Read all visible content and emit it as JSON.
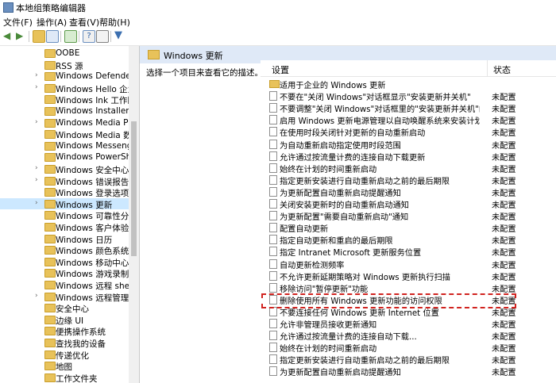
{
  "window": {
    "title": "本地组策略编辑器"
  },
  "menu": [
    "文件(F)",
    "操作(A)",
    "查看(V)",
    "帮助(H)"
  ],
  "toolbar_icons": [
    "back-icon",
    "forward-icon",
    "up-folder-icon",
    "show-hide-tree-icon",
    "export-icon",
    "help-icon",
    "properties-icon",
    "filter-icon"
  ],
  "tree": {
    "items": [
      {
        "label": "OOBE",
        "expandable": false
      },
      {
        "label": "RSS 源",
        "expandable": false
      },
      {
        "label": "Windows Defender Sr",
        "expandable": true
      },
      {
        "label": "Windows Hello 企业版",
        "expandable": true
      },
      {
        "label": "Windows Ink 工作区",
        "expandable": false
      },
      {
        "label": "Windows Installer",
        "expandable": false
      },
      {
        "label": "Windows Media Playe",
        "expandable": true
      },
      {
        "label": "Windows Media 数字权",
        "expandable": false
      },
      {
        "label": "Windows Messenger",
        "expandable": false
      },
      {
        "label": "Windows PowerShell",
        "expandable": false
      },
      {
        "label": "Windows 安全中心",
        "expandable": true
      },
      {
        "label": "Windows 错误报告",
        "expandable": true
      },
      {
        "label": "Windows 登录选项",
        "expandable": false
      },
      {
        "label": "Windows 更新",
        "expandable": true,
        "selected": true
      },
      {
        "label": "Windows 可靠性分析",
        "expandable": false
      },
      {
        "label": "Windows 客户体验改善",
        "expandable": false
      },
      {
        "label": "Windows 日历",
        "expandable": false
      },
      {
        "label": "Windows 颜色系统",
        "expandable": false
      },
      {
        "label": "Windows 移动中心",
        "expandable": false
      },
      {
        "label": "Windows 游戏录制和广",
        "expandable": false
      },
      {
        "label": "Windows 远程 shell",
        "expandable": false
      },
      {
        "label": "Windows 远程管理(Wi",
        "expandable": true
      },
      {
        "label": "安全中心",
        "expandable": false
      },
      {
        "label": "边缘 UI",
        "expandable": false
      },
      {
        "label": "便携操作系统",
        "expandable": false
      },
      {
        "label": "查找我的设备",
        "expandable": false
      },
      {
        "label": "传递优化",
        "expandable": false
      },
      {
        "label": "地图",
        "expandable": false
      },
      {
        "label": "工作文件夹",
        "expandable": false
      }
    ]
  },
  "right": {
    "header": "Windows 更新",
    "description": "选择一个项目来查看它的描述。",
    "col_setting": "设置",
    "col_state": "状态",
    "rows": [
      {
        "name": "适用于企业的 Windows 更新",
        "state": "",
        "folder": true
      },
      {
        "name": "不要在\"关闭 Windows\"对话框显示\"安装更新并关机\"",
        "state": "未配置"
      },
      {
        "name": "不要调整\"关闭 Windows\"对话框里的\"安装更新并关机\"的默...",
        "state": "未配置"
      },
      {
        "name": "启用 Windows 更新电源管理以自动唤醒系统来安装计划的...",
        "state": "未配置"
      },
      {
        "name": "在使用时段关闭针对更新的自动重新启动",
        "state": "未配置"
      },
      {
        "name": "为自动重新启动指定使用时段范围",
        "state": "未配置"
      },
      {
        "name": "允许通过按流量计费的连接自动下载更新",
        "state": "未配置"
      },
      {
        "name": "始终在计划的时间重新启动",
        "state": "未配置"
      },
      {
        "name": "指定更新安装进行自动重新启动之前的最后期限",
        "state": "未配置"
      },
      {
        "name": "为更新配置自动重新启动提醒通知",
        "state": "未配置"
      },
      {
        "name": "关闭安装更新时的自动重新启动通知",
        "state": "未配置"
      },
      {
        "name": "为更新配置\"需要自动重新启动\"通知",
        "state": "未配置"
      },
      {
        "name": "配置自动更新",
        "state": "未配置"
      },
      {
        "name": "指定自动更新和重启的最后期限",
        "state": "未配置"
      },
      {
        "name": "指定 Intranet Microsoft 更新服务位置",
        "state": "未配置"
      },
      {
        "name": "自动更新检测频率",
        "state": "未配置"
      },
      {
        "name": "不允许更新延期策略对 Windows 更新执行扫描",
        "state": "未配置"
      },
      {
        "name": "移除访问\"暂停更新\"功能",
        "state": "未配置"
      },
      {
        "name": "删除使用所有 Windows 更新功能的访问权限",
        "state": "未配置"
      },
      {
        "name": "不要连接任何 Windows 更新 Internet 位置",
        "state": "未配置"
      },
      {
        "name": "允许非管理员接收更新通知",
        "state": "未配置"
      },
      {
        "name": "允许通过按流量计费的连接自动下载...",
        "state": "未配置"
      },
      {
        "name": "始终在计划的时间重新启动",
        "state": "未配置"
      },
      {
        "name": "指定更新安装进行自动重新启动之前的最后期限",
        "state": "未配置"
      },
      {
        "name": "为更新配置自动重新启动提醒通知",
        "state": "未配置"
      }
    ]
  }
}
